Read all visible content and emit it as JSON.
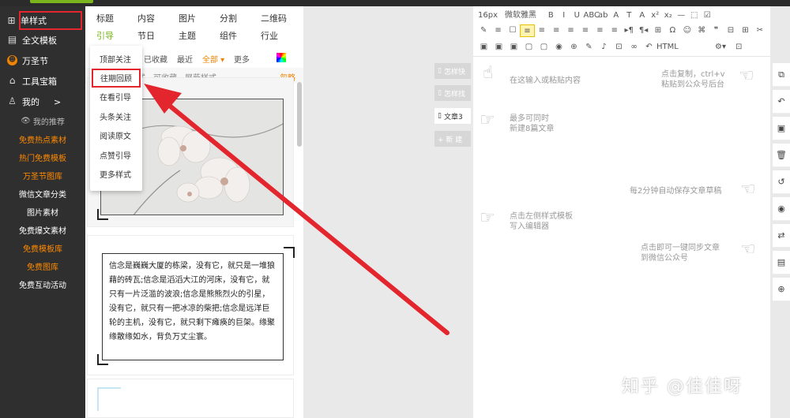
{
  "sidebar": {
    "main_items": [
      {
        "label": "单样式",
        "icon": "grid-icon"
      },
      {
        "label": "全文模板",
        "icon": "template-icon"
      },
      {
        "label": "万圣节",
        "icon": "pumpkin-icon"
      },
      {
        "label": "工具宝箱",
        "icon": "toolbox-icon"
      },
      {
        "label": "我的",
        "icon": "user-icon",
        "arrow": ">"
      }
    ],
    "sub_items": [
      {
        "label": "我的推荐",
        "style": "grey"
      },
      {
        "label": "免费热点素材",
        "style": "orange"
      },
      {
        "label": "热门免费模板",
        "style": "orange"
      },
      {
        "label": "万圣节图库",
        "style": "orange"
      },
      {
        "label": "微信文章分类",
        "style": "white"
      },
      {
        "label": "图片素材",
        "style": "white"
      },
      {
        "label": "免费爆文素材",
        "style": "white"
      },
      {
        "label": "免费模板库",
        "style": "orange"
      },
      {
        "label": "免费图库",
        "style": "orange"
      },
      {
        "label": "免费互动活动",
        "style": "white"
      }
    ]
  },
  "categories": {
    "row1": [
      "标题",
      "内容",
      "图片",
      "分割",
      "二维码"
    ],
    "row2": [
      "引导",
      "节日",
      "主题",
      "组件",
      "行业"
    ]
  },
  "filters": {
    "collect": "已收藏",
    "recent": "最近",
    "all": "全部 ▾",
    "more": "更多"
  },
  "hint": {
    "text": "式，可收藏、屏蔽样式。",
    "link": "忽略"
  },
  "dropdown": [
    "顶部关注",
    "往期回顾",
    "在看引导",
    "头条关注",
    "阅读原文",
    "点赞引导",
    "更多样式"
  ],
  "dropdown_selected": "往期回顾",
  "quote_text": "信念是巍巍大厦的栋梁，没有它，就只是一堆狼藉的砖瓦;信念是滔滔大江的河床，没有它，就只有一片泛滥的波浪;信念是熊熊烈火的引星，没有它，就只有一把冰凉的柴把;信念是远洋巨轮的主机，没有它，就只剩下瘫痪的巨架。缘聚缘散缘如水，背负万丈尘寰。",
  "doc_tabs": [
    {
      "label": "怎样快"
    },
    {
      "label": "怎样找"
    },
    {
      "label": "文章3"
    },
    {
      "label": "+ 新 建"
    }
  ],
  "toolbar": {
    "font_size": "16px",
    "font_family": "微软雅黑",
    "row1_icons": [
      "B",
      "I",
      "U",
      "ABC",
      "ab",
      "A",
      "T",
      "A",
      "x²",
      "x₂",
      "—",
      "⬚",
      "☑"
    ],
    "row2_icons": [
      "✎",
      "≡",
      "☐",
      "≡",
      "≡",
      "≡",
      "≡",
      "≡",
      "≡",
      "≡",
      "▸¶",
      "¶◂",
      "⊞",
      "Ω",
      "☺",
      "⌘",
      "❞",
      "⊟",
      "⊞",
      "✂"
    ],
    "row3_icons": [
      "▣",
      "▣",
      "▣",
      "▢",
      "▢",
      "◉",
      "⊕",
      "✎",
      "♪",
      "⊡",
      "∞",
      "↶",
      "HTML"
    ]
  },
  "tips": {
    "paste": "在这输入或粘贴内容",
    "copy_line1": "点击复制，ctrl+v",
    "copy_line2": "粘贴到公众号后台",
    "multi_line1": "最多可同时",
    "multi_line2": "新建8篇文章",
    "autosave": "每2分钟自动保存文章草稿",
    "insert_line1": "点击左侧样式模板",
    "insert_line2": "写入编辑器",
    "sync_line1": "点击即可一键同步文章",
    "sync_line2": "到微信公众号"
  },
  "watermark": "知乎 @佳佳呀",
  "right_tools": [
    "copy-icon",
    "undo-icon",
    "save-icon",
    "trash-icon",
    "history-icon",
    "preview-icon",
    "swap-icon",
    "export-icon",
    "zoom-icon"
  ],
  "colors": {
    "accent": "#7ab51d",
    "highlight": "#e3262e",
    "orange": "#ff8a00",
    "sidebar": "#2f2f2f"
  }
}
